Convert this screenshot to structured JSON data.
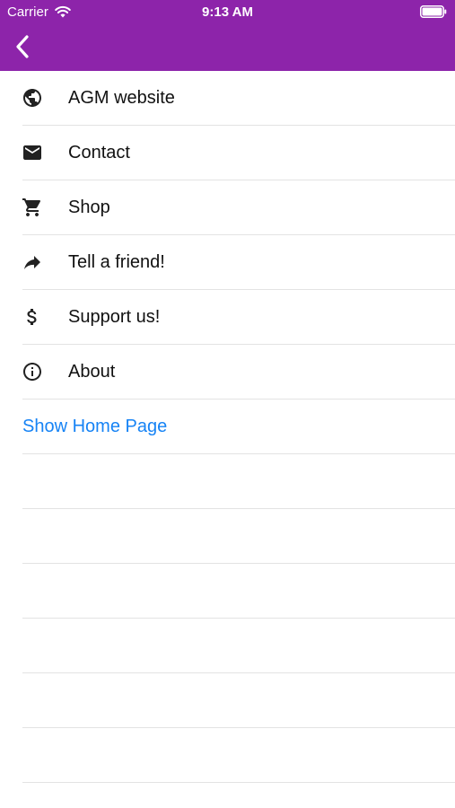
{
  "status_bar": {
    "carrier": "Carrier",
    "time": "9:13 AM",
    "wifi_icon": "wifi-icon",
    "battery_icon": "battery-icon"
  },
  "nav": {
    "back_icon": "chevron-left-icon",
    "bar_color": "#8d24aa"
  },
  "menu": {
    "items": [
      {
        "label": "AGM website",
        "icon": "globe-icon"
      },
      {
        "label": "Contact",
        "icon": "mail-icon"
      },
      {
        "label": "Shop",
        "icon": "cart-icon"
      },
      {
        "label": "Tell a friend!",
        "icon": "share-arrow-icon"
      },
      {
        "label": "Support us!",
        "icon": "dollar-icon"
      },
      {
        "label": "About",
        "icon": "info-icon"
      }
    ],
    "link": {
      "label": "Show Home Page",
      "color": "#1683f5"
    }
  }
}
